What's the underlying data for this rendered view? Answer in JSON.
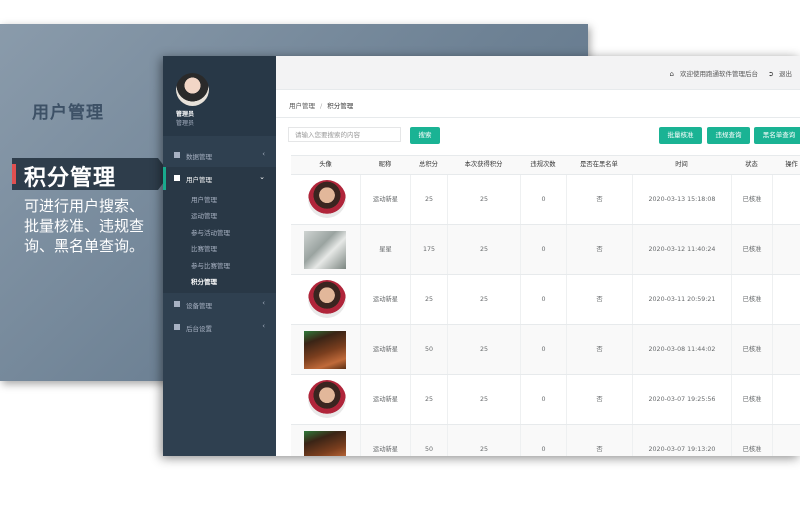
{
  "promo": {
    "bg_title": "用户管理",
    "feature_title": "积分管理",
    "feature_desc": "可进行用户搜索、批量核准、违规查询、黑名单查询。"
  },
  "app": {
    "profile": {
      "name": "管理员",
      "role": "管理员"
    },
    "menu": [
      {
        "label": "数据管理",
        "icon": "grid-icon",
        "arrow": "‹",
        "active": false
      },
      {
        "label": "用户管理",
        "icon": "document-icon",
        "arrow": "⌄",
        "active": true,
        "children": [
          {
            "label": "用户管理",
            "current": false
          },
          {
            "label": "运动管理",
            "current": false
          },
          {
            "label": "参与活动管理",
            "current": false
          },
          {
            "label": "比赛管理",
            "current": false
          },
          {
            "label": "参与比赛管理",
            "current": false
          },
          {
            "label": "积分管理",
            "current": true
          }
        ]
      },
      {
        "label": "设备管理",
        "icon": "grid-icon",
        "arrow": "‹",
        "active": false
      },
      {
        "label": "后台设置",
        "icon": "grid-icon",
        "arrow": "‹",
        "active": false
      }
    ],
    "topbar": {
      "welcome": "欢迎使用跑通软件管理后台",
      "logout": "退出"
    },
    "breadcrumb": {
      "parent": "用户管理",
      "sep": "/",
      "current": "积分管理"
    },
    "toolbar": {
      "search_placeholder": "请输入您要搜索的内容",
      "search_button": "搜索",
      "batch_button": "批量核准",
      "violation_button": "违规查询",
      "blacklist_button": "黑名单查询"
    },
    "table": {
      "headers": [
        "头像",
        "昵称",
        "总积分",
        "本次获得积分",
        "违规次数",
        "是否在黑名单",
        "时间",
        "状态",
        "操作"
      ],
      "rows": [
        {
          "avatar": "person",
          "nickname": "运动新星",
          "total": "25",
          "gained": "25",
          "violations": "0",
          "blacklist": "否",
          "time": "2020-03-13 15:18:08",
          "status": "已核准"
        },
        {
          "avatar": "cat",
          "nickname": "星星",
          "total": "175",
          "gained": "25",
          "violations": "0",
          "blacklist": "否",
          "time": "2020-03-12 11:40:24",
          "status": "已核准"
        },
        {
          "avatar": "person",
          "nickname": "运动新星",
          "total": "25",
          "gained": "25",
          "violations": "0",
          "blacklist": "否",
          "time": "2020-03-11 20:59:21",
          "status": "已核准"
        },
        {
          "avatar": "dog",
          "nickname": "运动新星",
          "total": "50",
          "gained": "25",
          "violations": "0",
          "blacklist": "否",
          "time": "2020-03-08 11:44:02",
          "status": "已核准"
        },
        {
          "avatar": "person",
          "nickname": "运动新星",
          "total": "25",
          "gained": "25",
          "violations": "0",
          "blacklist": "否",
          "time": "2020-03-07 19:25:56",
          "status": "已核准"
        },
        {
          "avatar": "dog",
          "nickname": "运动新星",
          "total": "50",
          "gained": "25",
          "violations": "0",
          "blacklist": "否",
          "time": "2020-03-07 19:13:20",
          "status": "已核准"
        }
      ]
    }
  }
}
